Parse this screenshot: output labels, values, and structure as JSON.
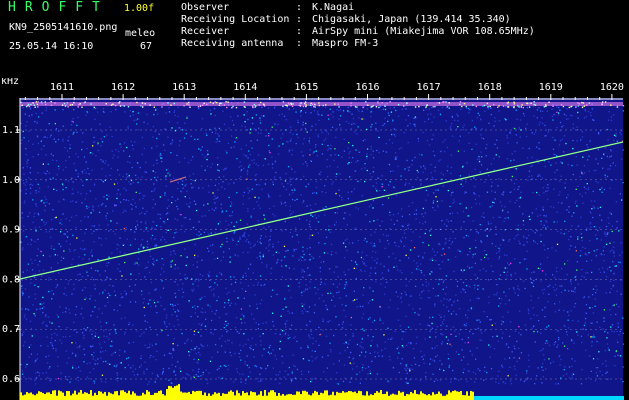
{
  "header": {
    "brand": "HROFFT",
    "version": "1.00f",
    "filename": "KN9_2505141610.png",
    "meleo_label": "meleo",
    "meleo_value": "67",
    "timestamp": "25.05.14 16:10"
  },
  "station": {
    "observer_label": "Observer",
    "observer": "K.Nagai",
    "location_label": "Receiving Location",
    "location": "Chigasaki, Japan (139.414 35.340)",
    "receiver_label": "Receiver",
    "receiver": "AirSpy mini (Miakejima VOR 108.65MHz)",
    "antenna_label": "Receiving antenna",
    "antenna": "Maspro FM-3",
    "separator": ":"
  },
  "spectrogram": {
    "y_unit": "kHz",
    "y_ticks": [
      "1.1",
      "1.0",
      "0.9",
      "0.8",
      "0.7",
      "0.6"
    ],
    "x_ticks": [
      "1611",
      "1612",
      "1613",
      "1614",
      "1615",
      "1616",
      "1617",
      "1618",
      "1619",
      "1620"
    ],
    "colors": {
      "background": "#10168a",
      "noise": [
        "#2a3ad0",
        "#3a5cff",
        "#00aaff",
        "#22ffee",
        "#33ff66",
        "#ffff33",
        "#ff6655",
        "#ff33ff"
      ],
      "trail": "#66ff77",
      "carrier": "#ff88ff",
      "grid": "#ffffcc",
      "bottom_bar": "#ffff00",
      "bottom_bar_right": "#00d8ff"
    }
  }
}
